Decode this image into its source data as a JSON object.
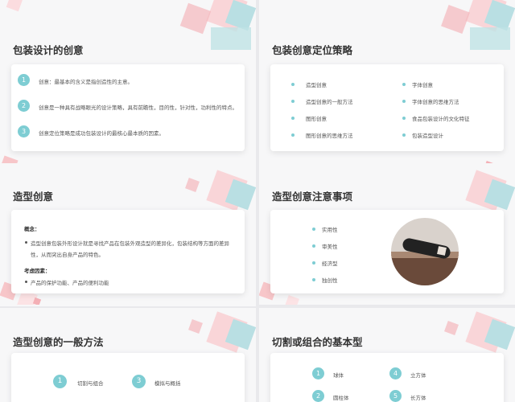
{
  "slides": {
    "s1": {
      "title": "包装设计的创意",
      "items": [
        {
          "num": "1",
          "text": "创意：最基本的含义是指创造性的主意。"
        },
        {
          "num": "2",
          "text": "创意是一种具有战略眼光的设计策略，具有前瞻性，目的性，针对性，功利性的特点。"
        },
        {
          "num": "3",
          "text": "创意定位策略是成功包装设计的最核心最本质的因素。"
        }
      ]
    },
    "s2": {
      "title": "包装创意定位策略",
      "left": [
        "造型创意",
        "造型创意的一般方法",
        "图形创意",
        "图形创意的思维方法"
      ],
      "right": [
        "字体创意",
        "字体创意的思维方法",
        "食品包装设计的文化特征",
        "包装造型设计"
      ]
    },
    "s3": {
      "title": "造型创意",
      "concept_label": "概念：",
      "concept_line1": "造型创意包装外形设计就是寻找产品在包装外观造型的差异化，包装结构等方面的差异",
      "concept_line2": "性，从而突出自身产品的特色。",
      "factors_label": "考虑因素：",
      "factors_text": "产品的保护功能、产品的便利功能"
    },
    "s4": {
      "title": "造型创意注意事项",
      "items": [
        "实用性",
        "审美性",
        "经济型",
        "独创性"
      ]
    },
    "s5": {
      "title": "造型创意的一般方法",
      "items": [
        {
          "num": "1",
          "text": "切割与组合"
        },
        {
          "num": "3",
          "text": "模拟与概括"
        }
      ]
    },
    "s6": {
      "title": "切割或组合的基本型",
      "items": [
        {
          "num": "1",
          "text": "球体"
        },
        {
          "num": "4",
          "text": "立方体"
        },
        {
          "num": "2",
          "text": "圆柱体"
        },
        {
          "num": "5",
          "text": "长方体"
        }
      ]
    }
  },
  "colors": {
    "accent": "#7ecdd3",
    "pink": "#f7c6c9",
    "teal": "#a7d8dc"
  }
}
